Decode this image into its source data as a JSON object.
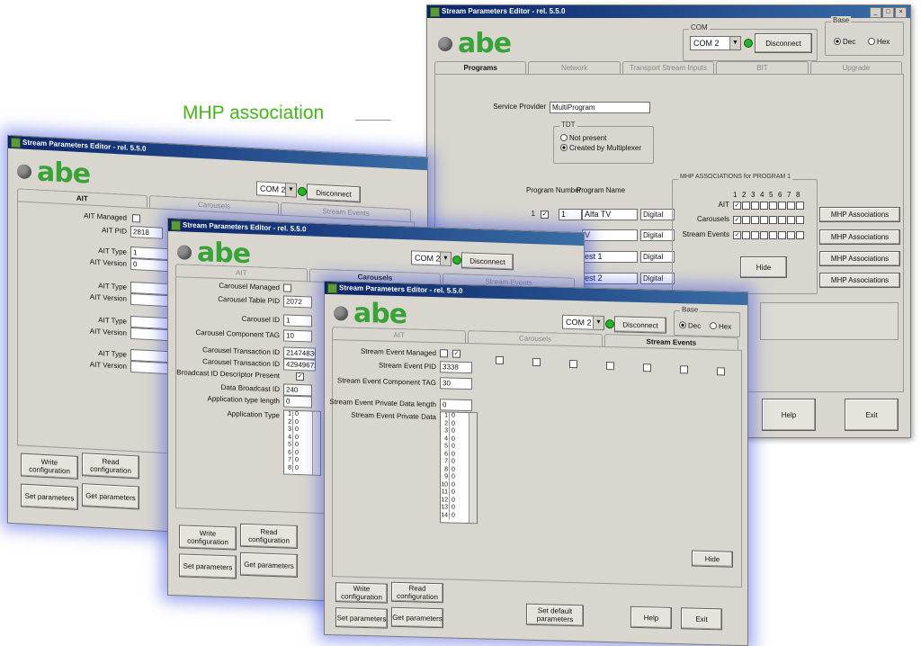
{
  "annotation": "MHP association",
  "title": "Stream Parameters Editor - rel. 5.5.0",
  "logo": "abe",
  "com": {
    "label": "COM",
    "value": "COM 2",
    "disconnect": "Disconnect"
  },
  "base": {
    "label": "Base",
    "dec": "Dec",
    "hex": "Hex"
  },
  "main": {
    "tabs": [
      "Programs",
      "Network",
      "Transport Stream Inputs",
      "BIT",
      "Upgrade"
    ],
    "service_provider_label": "Service Provider",
    "service_provider_value": "MultiProgram",
    "tdt": {
      "label": "TDT",
      "not_present": "Not present",
      "created": "Created by Multiplexer"
    },
    "col_program_number": "Program Number",
    "col_program_name": "Program Name",
    "rows": [
      {
        "idx": "1",
        "number": "1",
        "name": "Alfa TV",
        "type": "Digital"
      },
      {
        "idx": "",
        "number": "",
        "name": "V",
        "type": "Digital"
      },
      {
        "idx": "",
        "number": "",
        "name": "est 1",
        "type": "Digital"
      },
      {
        "idx": "",
        "number": "",
        "name": "est 2",
        "type": "Digital"
      }
    ],
    "mhp_group_label": "MHP ASSOCIATIONS for PROGRAM 1",
    "mhp_cols": [
      "1",
      "2",
      "3",
      "4",
      "5",
      "6",
      "7",
      "8"
    ],
    "mhp_rows": [
      "AIT",
      "Carousels",
      "Stream Events"
    ],
    "hide": "Hide",
    "mhp_buttons": [
      "MHP Associations",
      "MHP Associations",
      "MHP Associations",
      "MHP Associations"
    ],
    "help": "Help",
    "exit": "Exit"
  },
  "ait": {
    "tabs": [
      "AIT",
      "Carousels",
      "Stream Events"
    ],
    "ait_managed": "AIT Managed",
    "ait_pid_label": "AIT PID",
    "ait_pid_value": "2818",
    "ait_type_label": "AIT Type",
    "ait_type_value": "1",
    "ait_version_label": "AIT Version",
    "ait_version_value": "0",
    "write": "Write configuration",
    "read": "Read configuration",
    "set": "Set parameters",
    "get": "Get parameters"
  },
  "carousels": {
    "tabs": [
      "AIT",
      "Carousels",
      "Stream Events"
    ],
    "managed": "Carousel Managed",
    "table_pid_label": "Carousel Table PID",
    "table_pid_value": "2072",
    "id_label": "Carousel ID",
    "id_value": "1",
    "tag_label": "Carousel Component TAG",
    "tag_value": "10",
    "trans1_label": "Carousel Transaction ID",
    "trans1_value": "2147483648",
    "trans2_label": "Carousel Transaction ID",
    "trans2_value": "4294967295",
    "bcast_desc_label": "Broadcast ID Descriptor Present",
    "bcast_id_label": "Data Broadcast ID",
    "bcast_id_value": "240",
    "app_len_label": "Application type length",
    "app_len_value": "0",
    "app_type_label": "Application Type",
    "app_rows": [
      "1",
      "2",
      "3",
      "4",
      "5",
      "6",
      "7",
      "8"
    ],
    "write": "Write configuration",
    "read": "Read configuration",
    "set": "Set parameters",
    "get": "Get parameters"
  },
  "streams": {
    "tabs": [
      "AIT",
      "Carousels",
      "Stream Events"
    ],
    "managed": "Stream Event Managed",
    "pid_label": "Stream Event PID",
    "pid_value": "3338",
    "tag_label": "Stream Event Component TAG",
    "tag_value": "30",
    "priv_len_label": "Stream Event Private Data length",
    "priv_len_value": "0",
    "priv_data_label": "Stream Event Private Data",
    "priv_rows": [
      "1",
      "2",
      "3",
      "4",
      "5",
      "6",
      "7",
      "8",
      "9",
      "10",
      "11",
      "12",
      "13",
      "14"
    ],
    "hide": "Hide",
    "write": "Write configuration",
    "read": "Read configuration",
    "set": "Set parameters",
    "get": "Get parameters",
    "set_default": "Set default parameters",
    "help": "Help",
    "exit": "Exit"
  },
  "list_value": "0",
  "colors": {
    "logo_green": "#39a33a",
    "annotation_green": "#44b51a",
    "glow": "#4a5fdc"
  }
}
